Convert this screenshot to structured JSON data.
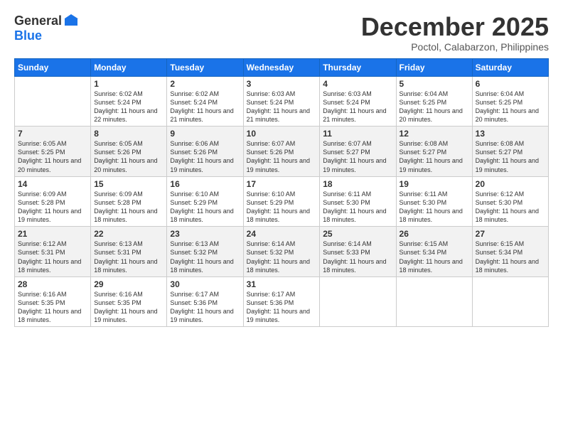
{
  "logo": {
    "general": "General",
    "blue": "Blue"
  },
  "title": "December 2025",
  "location": "Poctol, Calabarzon, Philippines",
  "weekdays": [
    "Sunday",
    "Monday",
    "Tuesday",
    "Wednesday",
    "Thursday",
    "Friday",
    "Saturday"
  ],
  "weeks": [
    [
      {
        "day": "",
        "sunrise": "",
        "sunset": "",
        "daylight": ""
      },
      {
        "day": "1",
        "sunrise": "Sunrise: 6:02 AM",
        "sunset": "Sunset: 5:24 PM",
        "daylight": "Daylight: 11 hours and 22 minutes."
      },
      {
        "day": "2",
        "sunrise": "Sunrise: 6:02 AM",
        "sunset": "Sunset: 5:24 PM",
        "daylight": "Daylight: 11 hours and 21 minutes."
      },
      {
        "day": "3",
        "sunrise": "Sunrise: 6:03 AM",
        "sunset": "Sunset: 5:24 PM",
        "daylight": "Daylight: 11 hours and 21 minutes."
      },
      {
        "day": "4",
        "sunrise": "Sunrise: 6:03 AM",
        "sunset": "Sunset: 5:24 PM",
        "daylight": "Daylight: 11 hours and 21 minutes."
      },
      {
        "day": "5",
        "sunrise": "Sunrise: 6:04 AM",
        "sunset": "Sunset: 5:25 PM",
        "daylight": "Daylight: 11 hours and 20 minutes."
      },
      {
        "day": "6",
        "sunrise": "Sunrise: 6:04 AM",
        "sunset": "Sunset: 5:25 PM",
        "daylight": "Daylight: 11 hours and 20 minutes."
      }
    ],
    [
      {
        "day": "7",
        "sunrise": "Sunrise: 6:05 AM",
        "sunset": "Sunset: 5:25 PM",
        "daylight": "Daylight: 11 hours and 20 minutes."
      },
      {
        "day": "8",
        "sunrise": "Sunrise: 6:05 AM",
        "sunset": "Sunset: 5:26 PM",
        "daylight": "Daylight: 11 hours and 20 minutes."
      },
      {
        "day": "9",
        "sunrise": "Sunrise: 6:06 AM",
        "sunset": "Sunset: 5:26 PM",
        "daylight": "Daylight: 11 hours and 19 minutes."
      },
      {
        "day": "10",
        "sunrise": "Sunrise: 6:07 AM",
        "sunset": "Sunset: 5:26 PM",
        "daylight": "Daylight: 11 hours and 19 minutes."
      },
      {
        "day": "11",
        "sunrise": "Sunrise: 6:07 AM",
        "sunset": "Sunset: 5:27 PM",
        "daylight": "Daylight: 11 hours and 19 minutes."
      },
      {
        "day": "12",
        "sunrise": "Sunrise: 6:08 AM",
        "sunset": "Sunset: 5:27 PM",
        "daylight": "Daylight: 11 hours and 19 minutes."
      },
      {
        "day": "13",
        "sunrise": "Sunrise: 6:08 AM",
        "sunset": "Sunset: 5:27 PM",
        "daylight": "Daylight: 11 hours and 19 minutes."
      }
    ],
    [
      {
        "day": "14",
        "sunrise": "Sunrise: 6:09 AM",
        "sunset": "Sunset: 5:28 PM",
        "daylight": "Daylight: 11 hours and 19 minutes."
      },
      {
        "day": "15",
        "sunrise": "Sunrise: 6:09 AM",
        "sunset": "Sunset: 5:28 PM",
        "daylight": "Daylight: 11 hours and 18 minutes."
      },
      {
        "day": "16",
        "sunrise": "Sunrise: 6:10 AM",
        "sunset": "Sunset: 5:29 PM",
        "daylight": "Daylight: 11 hours and 18 minutes."
      },
      {
        "day": "17",
        "sunrise": "Sunrise: 6:10 AM",
        "sunset": "Sunset: 5:29 PM",
        "daylight": "Daylight: 11 hours and 18 minutes."
      },
      {
        "day": "18",
        "sunrise": "Sunrise: 6:11 AM",
        "sunset": "Sunset: 5:30 PM",
        "daylight": "Daylight: 11 hours and 18 minutes."
      },
      {
        "day": "19",
        "sunrise": "Sunrise: 6:11 AM",
        "sunset": "Sunset: 5:30 PM",
        "daylight": "Daylight: 11 hours and 18 minutes."
      },
      {
        "day": "20",
        "sunrise": "Sunrise: 6:12 AM",
        "sunset": "Sunset: 5:30 PM",
        "daylight": "Daylight: 11 hours and 18 minutes."
      }
    ],
    [
      {
        "day": "21",
        "sunrise": "Sunrise: 6:12 AM",
        "sunset": "Sunset: 5:31 PM",
        "daylight": "Daylight: 11 hours and 18 minutes."
      },
      {
        "day": "22",
        "sunrise": "Sunrise: 6:13 AM",
        "sunset": "Sunset: 5:31 PM",
        "daylight": "Daylight: 11 hours and 18 minutes."
      },
      {
        "day": "23",
        "sunrise": "Sunrise: 6:13 AM",
        "sunset": "Sunset: 5:32 PM",
        "daylight": "Daylight: 11 hours and 18 minutes."
      },
      {
        "day": "24",
        "sunrise": "Sunrise: 6:14 AM",
        "sunset": "Sunset: 5:32 PM",
        "daylight": "Daylight: 11 hours and 18 minutes."
      },
      {
        "day": "25",
        "sunrise": "Sunrise: 6:14 AM",
        "sunset": "Sunset: 5:33 PM",
        "daylight": "Daylight: 11 hours and 18 minutes."
      },
      {
        "day": "26",
        "sunrise": "Sunrise: 6:15 AM",
        "sunset": "Sunset: 5:34 PM",
        "daylight": "Daylight: 11 hours and 18 minutes."
      },
      {
        "day": "27",
        "sunrise": "Sunrise: 6:15 AM",
        "sunset": "Sunset: 5:34 PM",
        "daylight": "Daylight: 11 hours and 18 minutes."
      }
    ],
    [
      {
        "day": "28",
        "sunrise": "Sunrise: 6:16 AM",
        "sunset": "Sunset: 5:35 PM",
        "daylight": "Daylight: 11 hours and 18 minutes."
      },
      {
        "day": "29",
        "sunrise": "Sunrise: 6:16 AM",
        "sunset": "Sunset: 5:35 PM",
        "daylight": "Daylight: 11 hours and 19 minutes."
      },
      {
        "day": "30",
        "sunrise": "Sunrise: 6:17 AM",
        "sunset": "Sunset: 5:36 PM",
        "daylight": "Daylight: 11 hours and 19 minutes."
      },
      {
        "day": "31",
        "sunrise": "Sunrise: 6:17 AM",
        "sunset": "Sunset: 5:36 PM",
        "daylight": "Daylight: 11 hours and 19 minutes."
      },
      {
        "day": "",
        "sunrise": "",
        "sunset": "",
        "daylight": ""
      },
      {
        "day": "",
        "sunrise": "",
        "sunset": "",
        "daylight": ""
      },
      {
        "day": "",
        "sunrise": "",
        "sunset": "",
        "daylight": ""
      }
    ]
  ]
}
